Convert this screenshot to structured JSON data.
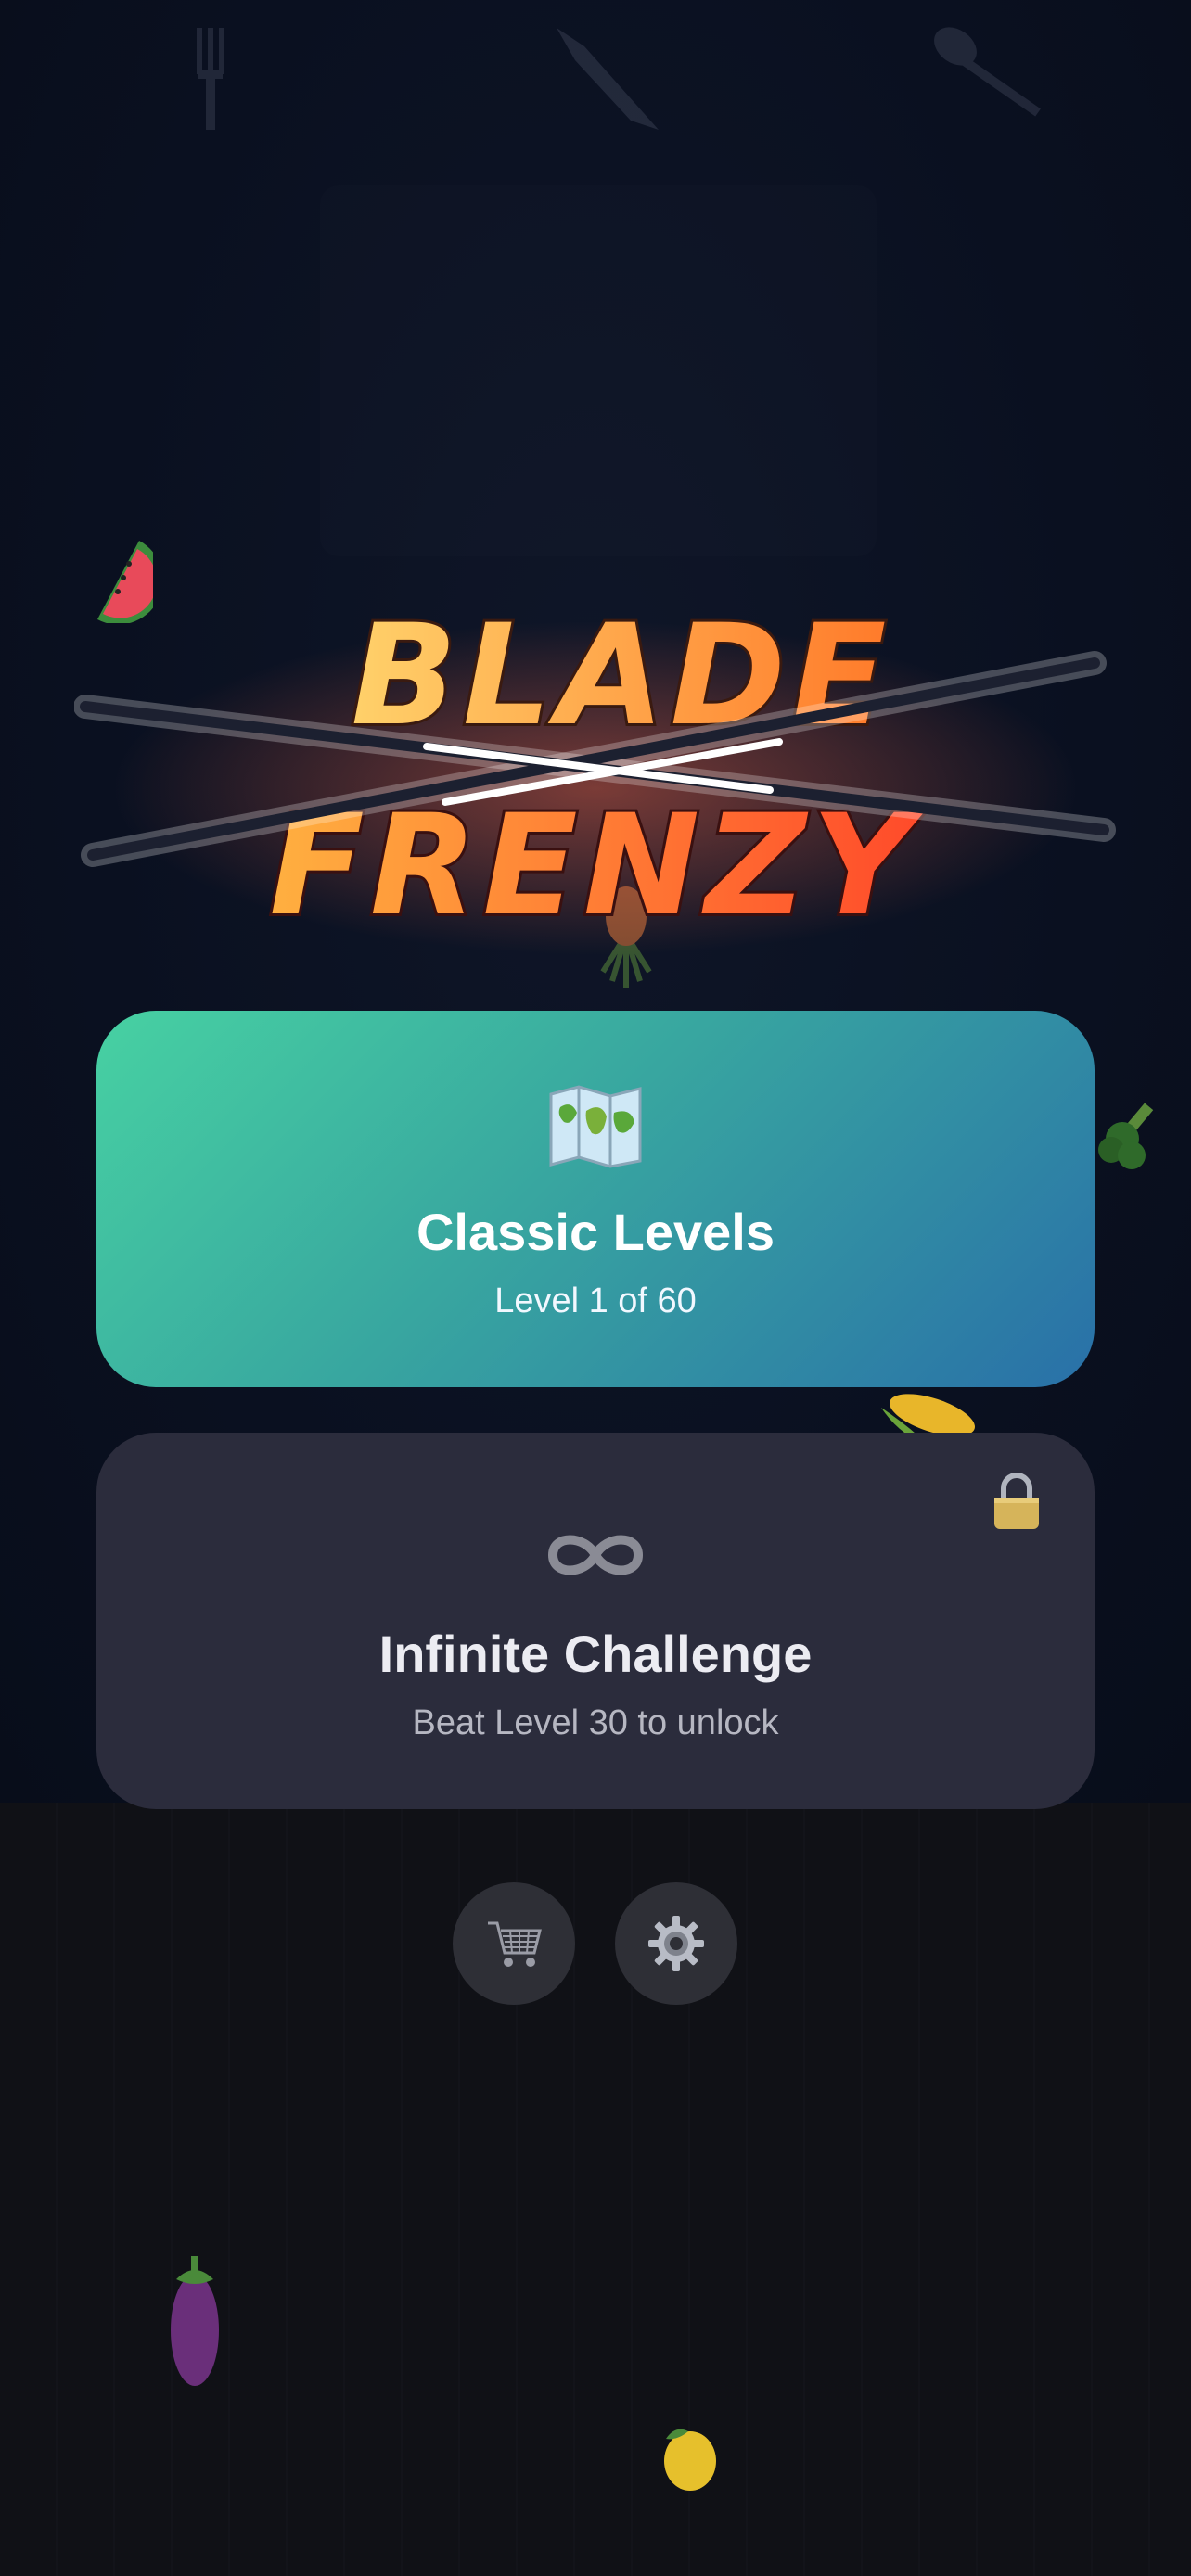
{
  "title": {
    "line1": "BLADE",
    "line2": "FRENZY"
  },
  "modes": {
    "classic": {
      "icon": "world-map-icon",
      "title": "Classic Levels",
      "subtitle": "Level 1 of 60"
    },
    "infinite": {
      "icon": "infinity-icon",
      "title": "Infinite Challenge",
      "subtitle": "Beat Level 30 to unlock",
      "locked": true,
      "lock_icon": "lock-icon"
    }
  },
  "bottom_buttons": [
    {
      "icon": "shopping-cart-icon"
    },
    {
      "icon": "gear-icon"
    }
  ],
  "decorations": [
    "fork-icon",
    "knife-icon",
    "spoon-icon",
    "watermelon-icon",
    "pineapple-icon",
    "broccoli-icon",
    "corn-icon",
    "eggplant-icon",
    "lemon-icon"
  ],
  "colors": {
    "background": "#0a0f1e",
    "classic_gradient_start": "#47d1a2",
    "classic_gradient_end": "#2970a8",
    "infinite_card": "#2b2c3c",
    "title_orange": "#ff8a3a",
    "title_yellow": "#ffc45a"
  }
}
